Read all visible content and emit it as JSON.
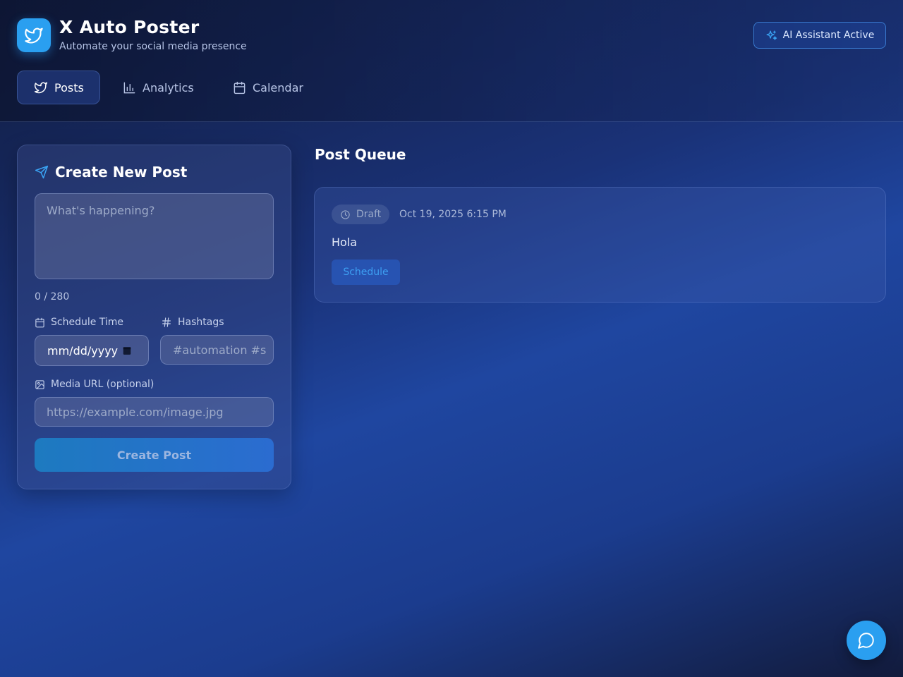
{
  "app": {
    "title": "X Auto Poster",
    "subtitle": "Automate your social media presence",
    "logo_icon": "twitter-bird-icon",
    "ai_badge": "AI Assistant Active"
  },
  "nav": {
    "tabs": [
      {
        "label": "Posts",
        "icon": "twitter-bird-icon",
        "active": true
      },
      {
        "label": "Analytics",
        "icon": "bar-chart-icon",
        "active": false
      },
      {
        "label": "Calendar",
        "icon": "calendar-icon",
        "active": false
      }
    ]
  },
  "create_post": {
    "title": "Create New Post",
    "content_placeholder": "What's happening?",
    "counter": "0 / 280",
    "schedule_label": "Schedule Time",
    "schedule_value": "mm/dd/yyyy",
    "hashtags_label": "Hashtags",
    "hashtags_placeholder": "#automation #s",
    "media_label": "Media URL (optional)",
    "media_placeholder": "https://example.com/image.jpg",
    "submit_label": "Create Post"
  },
  "queue": {
    "title": "Post Queue",
    "posts": [
      {
        "status": "Draft",
        "date": "Oct 19, 2025 6:15 PM",
        "text": "Hola",
        "action_label": "Schedule"
      }
    ]
  },
  "colors": {
    "accent": "#2a9ff0",
    "background_start": "#111c3f",
    "background_mid": "#1f46a0"
  }
}
